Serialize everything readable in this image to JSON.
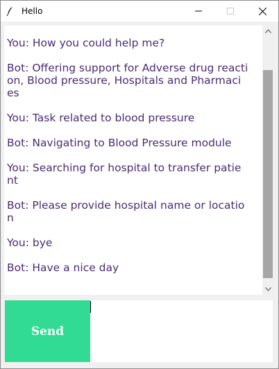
{
  "window": {
    "title": "Hello",
    "controls": {
      "minimize": "minimize",
      "maximize": "maximize",
      "close": "close"
    }
  },
  "chat": {
    "lines": [
      "You: How you could help me?",
      "",
      "Bot: Offering support for Adverse drug reacti",
      "on, Blood pressure, Hospitals and Pharmaci",
      "es",
      "",
      "You: Task related to blood pressure",
      "",
      "Bot: Navigating to Blood Pressure module",
      "",
      "You: Searching for hospital to transfer patie",
      "nt",
      "",
      "Bot: Please provide hospital name or locatio",
      "n",
      "",
      "You: bye",
      "",
      "Bot: Have a nice day"
    ]
  },
  "input": {
    "value": ""
  },
  "send_button": {
    "label": "Send"
  },
  "colors": {
    "chat_text": "#4a2b72",
    "send_bg": "#32db93",
    "send_text": "#ffffff",
    "scroll_thumb": "#a6a6a6"
  }
}
